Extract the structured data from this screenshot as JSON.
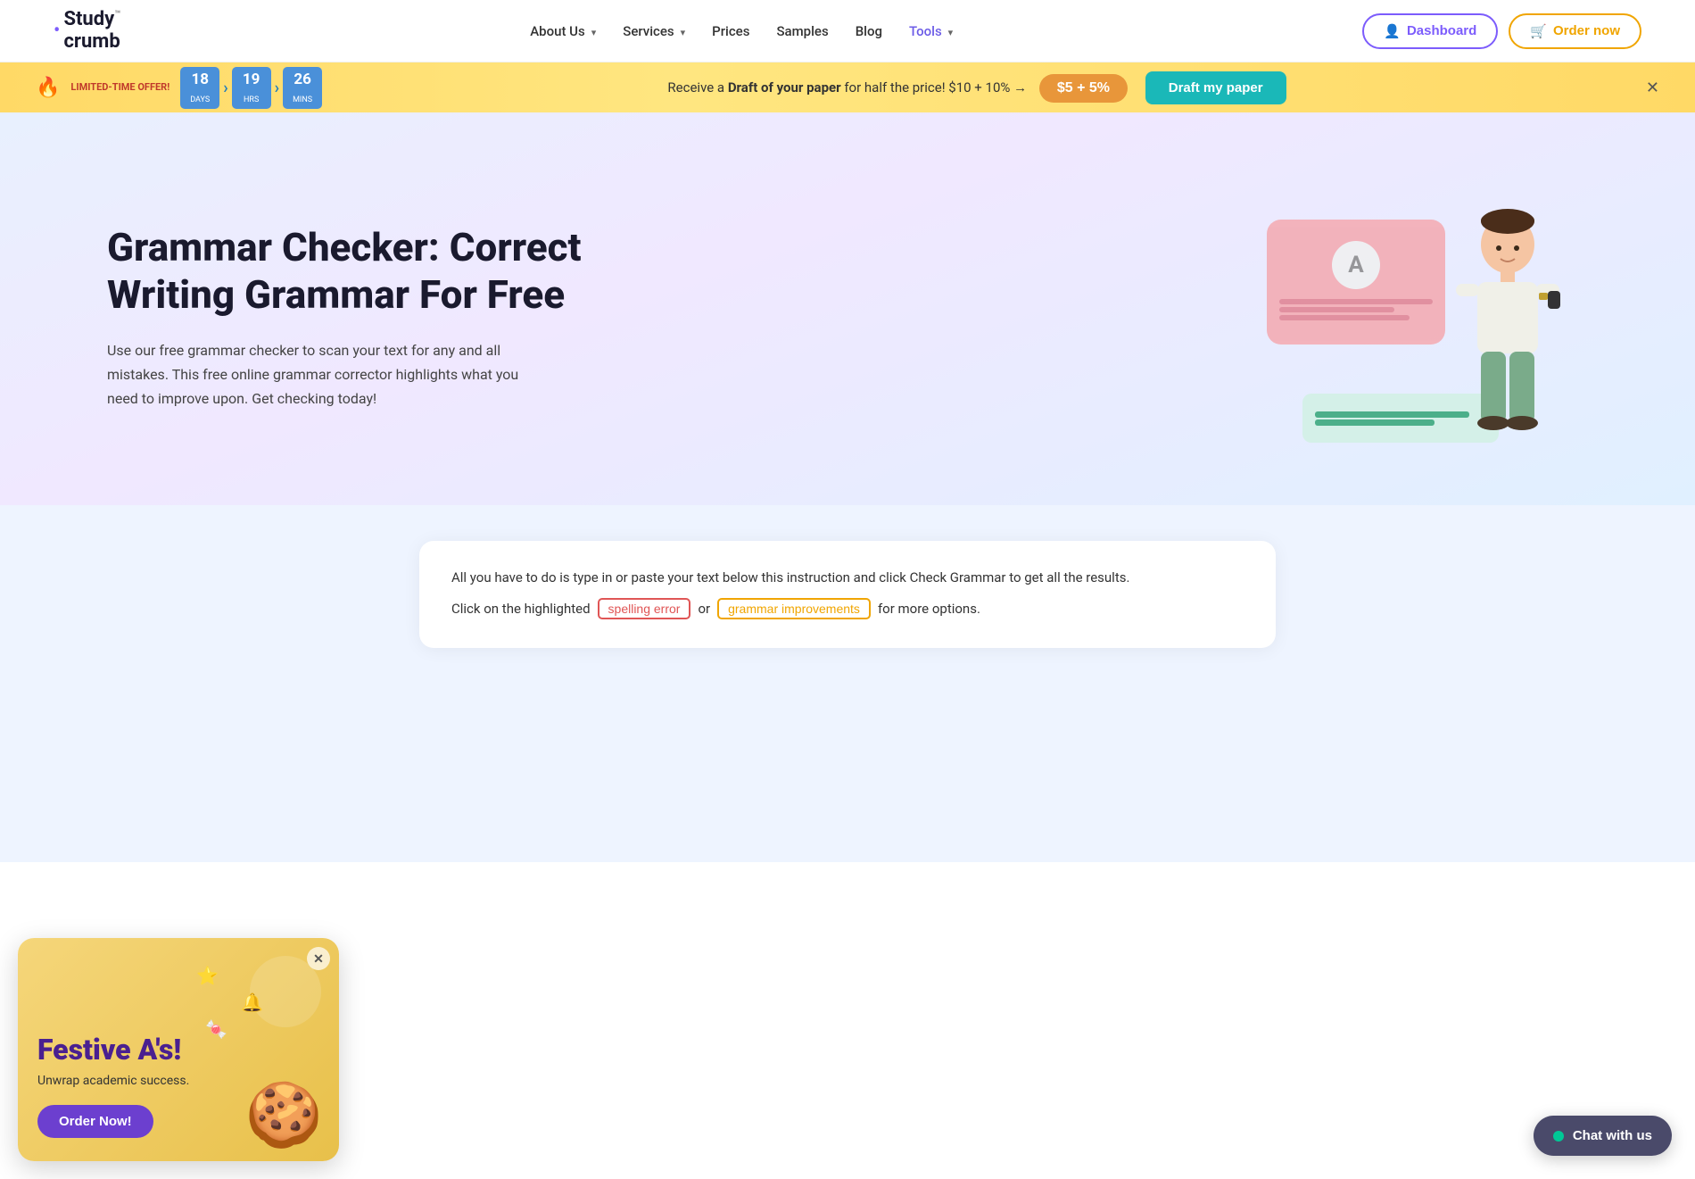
{
  "brand": {
    "dot": "•",
    "name_line1": "Study",
    "name_line2": "crumb",
    "tm": "™"
  },
  "navbar": {
    "links": [
      {
        "label": "About Us",
        "id": "about-us",
        "dropdown": true,
        "active": false
      },
      {
        "label": "Services",
        "id": "services",
        "dropdown": true,
        "active": false
      },
      {
        "label": "Prices",
        "id": "prices",
        "dropdown": false,
        "active": false
      },
      {
        "label": "Samples",
        "id": "samples",
        "dropdown": false,
        "active": false
      },
      {
        "label": "Blog",
        "id": "blog",
        "dropdown": false,
        "active": false
      },
      {
        "label": "Tools",
        "id": "tools",
        "dropdown": true,
        "active": true
      }
    ],
    "dashboard_label": "Dashboard",
    "order_label": "Order now"
  },
  "promo": {
    "label": "LIMITED-TIME OFFER!",
    "days": "18",
    "days_lbl": "days",
    "hrs": "19",
    "hrs_lbl": "hrs",
    "mins": "26",
    "mins_lbl": "mins",
    "message_start": "Receive a ",
    "message_bold": "Draft of your paper",
    "message_end": " for half the price! $10 + 10% →",
    "price_badge": "$5 + 5%",
    "cta_label": "Draft my paper"
  },
  "hero": {
    "title": "Grammar Checker: Correct Writing Grammar For Free",
    "description": "Use our free grammar checker to scan your text for any and all mistakes. This free online grammar corrector highlights what you need to improve upon. Get checking today!"
  },
  "grammar_box": {
    "instruction": "All you have to do is type in or paste your text below this instruction and click Check Grammar to get all the results.",
    "hint_prefix": "Click on the highlighted",
    "badge_spelling": "spelling error",
    "hint_or": "or",
    "badge_grammar": "grammar improvements",
    "hint_suffix": "for more options."
  },
  "festive": {
    "title": "Festive A's!",
    "subtitle": "Unwrap academic success.",
    "cta_label": "Order Now!"
  },
  "chat": {
    "label": "Chat with us"
  }
}
